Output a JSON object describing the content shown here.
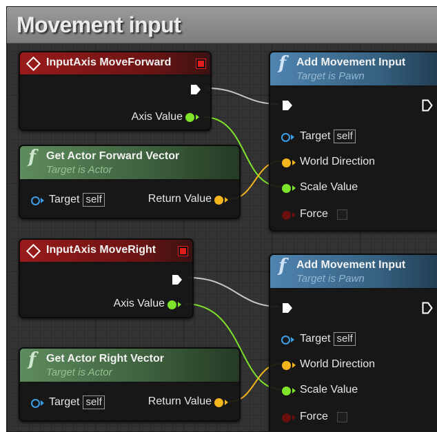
{
  "comment": {
    "title": "Movement input"
  },
  "nodes": {
    "event_forward": {
      "title": "InputAxis MoveForward",
      "axis_label": "Axis Value"
    },
    "event_right": {
      "title": "InputAxis MoveRight",
      "axis_label": "Axis Value"
    },
    "get_forward": {
      "title": "Get Actor Forward Vector",
      "subtitle": "Target is Actor",
      "target_label": "Target",
      "target_value": "self",
      "return_label": "Return Value"
    },
    "get_right": {
      "title": "Get Actor Right Vector",
      "subtitle": "Target is Actor",
      "target_label": "Target",
      "target_value": "self",
      "return_label": "Return Value"
    },
    "add_movement_1": {
      "title": "Add Movement Input",
      "subtitle": "Target is Pawn",
      "target_label": "Target",
      "target_value": "self",
      "world_direction_label": "World Direction",
      "scale_value_label": "Scale Value",
      "force_label": "Force",
      "force_checked": false
    },
    "add_movement_2": {
      "title": "Add Movement Input",
      "subtitle": "Target is Pawn",
      "target_label": "Target",
      "target_value": "self",
      "world_direction_label": "World Direction",
      "scale_value_label": "Scale Value",
      "force_label": "Force",
      "force_checked": false
    }
  },
  "colors": {
    "exec_wire": "#c8c8c8",
    "float_wire": "#7fe52b",
    "vector_wire": "#f5b51c",
    "object_pin": "#3a9fe8",
    "event_header": "#8a1818",
    "pure_header": "#4f7a4f",
    "function_header": "#3f6e92"
  }
}
